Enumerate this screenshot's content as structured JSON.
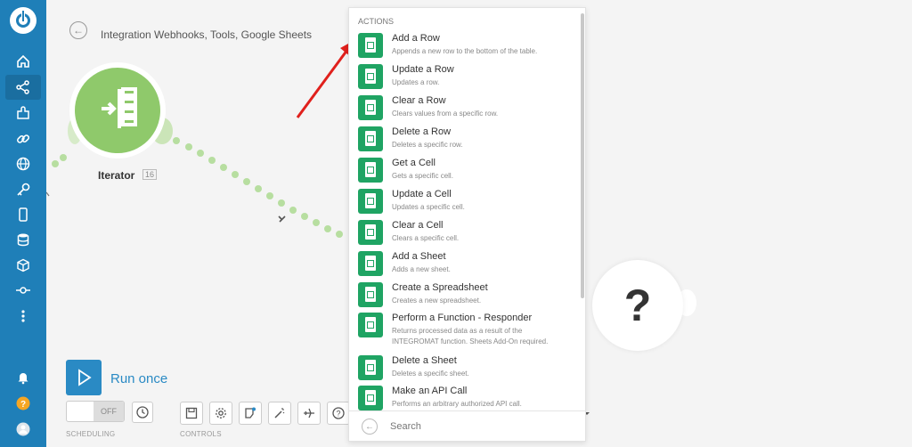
{
  "breadcrumb": "Integration Webhooks, Tools, Google Sheets",
  "iterator": {
    "label": "Iterator",
    "badge": "16"
  },
  "run": {
    "label": "Run once"
  },
  "scheduling": {
    "toggle_label": "OFF",
    "caption": "SCHEDULING"
  },
  "controls": {
    "caption": "CONTROLS"
  },
  "actions": {
    "title": "ACTIONS",
    "items": [
      {
        "title": "Add a Row",
        "desc": "Appends a new row to the bottom of the table."
      },
      {
        "title": "Update a Row",
        "desc": "Updates a row."
      },
      {
        "title": "Clear a Row",
        "desc": "Clears values from a specific row."
      },
      {
        "title": "Delete a Row",
        "desc": "Deletes a specific row."
      },
      {
        "title": "Get a Cell",
        "desc": "Gets a specific cell."
      },
      {
        "title": "Update a Cell",
        "desc": "Updates a specific cell."
      },
      {
        "title": "Clear a Cell",
        "desc": "Clears a specific cell."
      },
      {
        "title": "Add a Sheet",
        "desc": "Adds a new sheet."
      },
      {
        "title": "Create a Spreadsheet",
        "desc": "Creates a new spreadsheet."
      },
      {
        "title": "Perform a Function - Responder",
        "desc": "Returns processed data as a result of the INTEGROMAT function. Sheets Add-On required."
      },
      {
        "title": "Delete a Sheet",
        "desc": "Deletes a specific sheet."
      },
      {
        "title": "Make an API Call",
        "desc": "Performs an arbitrary authorized API call."
      }
    ],
    "search_placeholder": "Search"
  },
  "question_mark": "?",
  "colors": {
    "sidebar": "#1f7fb8",
    "sheets_green": "#1fa463",
    "iterator_green": "#8fc96b",
    "arrow_red": "#e0201c"
  },
  "icons": [
    "home-icon",
    "share-icon",
    "puzzle-icon",
    "link-icon",
    "globe-icon",
    "key-icon",
    "mobile-icon",
    "database-icon",
    "cube-icon",
    "flow-icon",
    "more-icon",
    "bell-icon",
    "help-icon",
    "avatar"
  ]
}
